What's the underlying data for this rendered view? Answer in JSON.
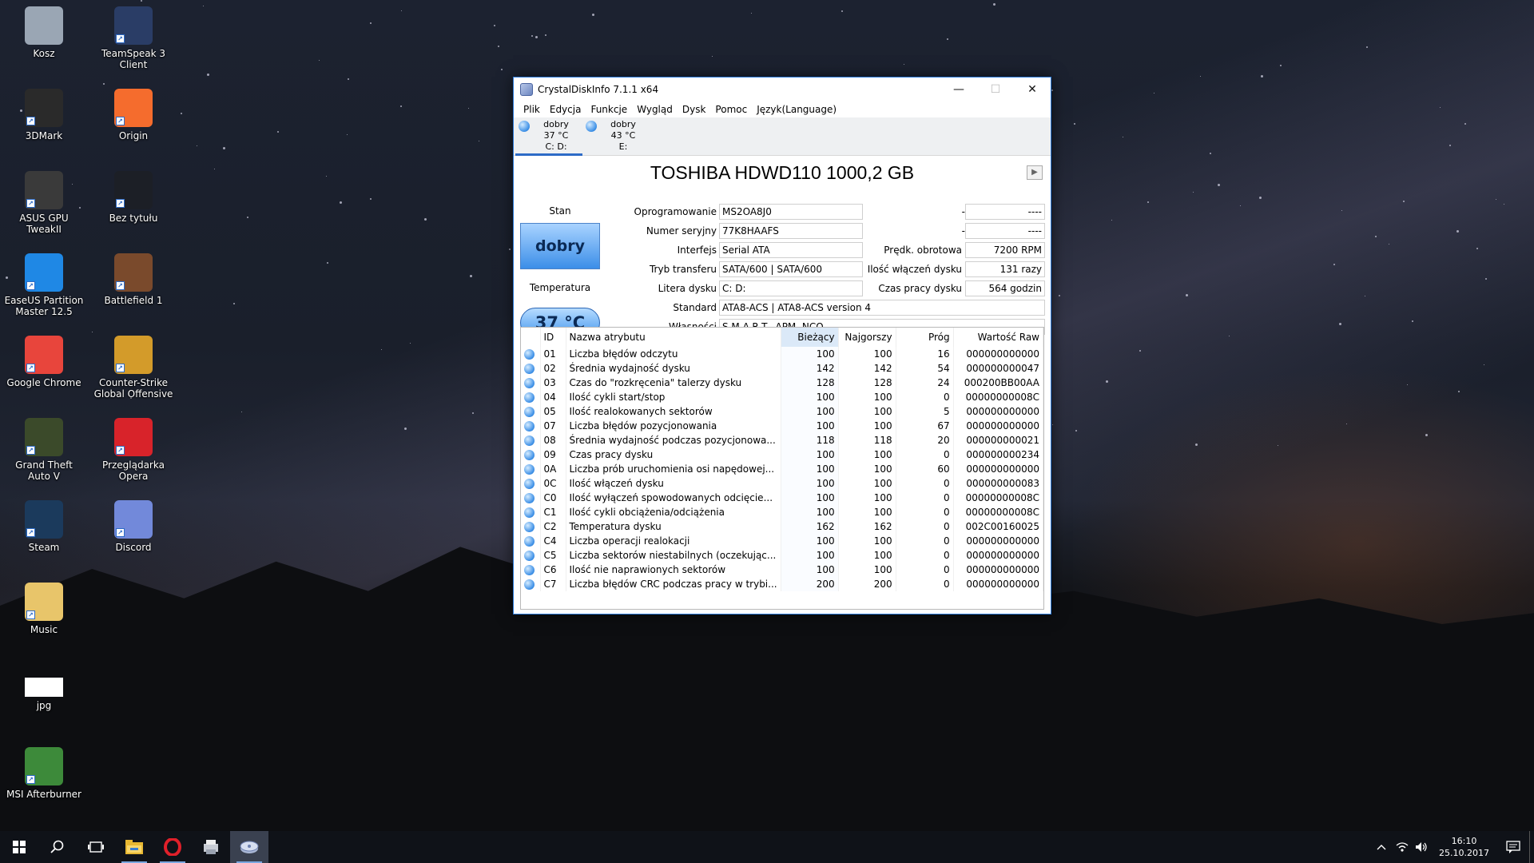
{
  "desktop": {
    "icons": [
      {
        "label": "Kosz",
        "icon": "recycle-bin-icon",
        "color": "#9aa6b4"
      },
      {
        "label": "TeamSpeak 3 Client",
        "icon": "teamspeak-icon",
        "color": "#2a3d66"
      },
      {
        "label": "3DMark",
        "icon": "3dmark-icon",
        "color": "#2a2a2a"
      },
      {
        "label": "Origin",
        "icon": "origin-icon",
        "color": "#f56c2d"
      },
      {
        "label": "ASUS GPU TweakII",
        "icon": "asus-gpu-tweak-icon",
        "color": "#3a3a3a"
      },
      {
        "label": "Bez tytułu",
        "icon": "untitled-image-icon",
        "color": "#1c1f26"
      },
      {
        "label": "EaseUS Partition Master 12.5",
        "icon": "easeus-icon",
        "color": "#1f88e5"
      },
      {
        "label": "Battlefield 1",
        "icon": "battlefield-icon",
        "color": "#7a4a2c"
      },
      {
        "label": "Google Chrome",
        "icon": "chrome-icon",
        "color": "#e8453c"
      },
      {
        "label": "Counter-Strike Global Offensive",
        "icon": "csgo-icon",
        "color": "#d39b2a"
      },
      {
        "label": "Grand Theft Auto V",
        "icon": "gta-icon",
        "color": "#3b4a2a"
      },
      {
        "label": "Przeglądarka Opera",
        "icon": "opera-icon",
        "color": "#d8232a"
      },
      {
        "label": "Steam",
        "icon": "steam-icon",
        "color": "#1b3a5c"
      },
      {
        "label": "Discord",
        "icon": "discord-icon",
        "color": "#7289da"
      },
      {
        "label": "Music",
        "icon": "music-folder-icon",
        "color": "#e8c56a"
      },
      {
        "label": "jpg",
        "icon": "blank-file-icon",
        "color": "#ffffff"
      },
      {
        "label": "MSI Afterburner",
        "icon": "msi-afterburner-icon",
        "color": "#3d8a3a"
      }
    ]
  },
  "window": {
    "title": "CrystalDiskInfo 7.1.1 x64",
    "menu": [
      "Plik",
      "Edycja",
      "Funkcje",
      "Wygląd",
      "Dysk",
      "Pomoc",
      "Język(Language)"
    ],
    "drives": [
      {
        "status": "dobry",
        "temp": "37 °C",
        "letter": "C: D:"
      },
      {
        "status": "dobry",
        "temp": "43 °C",
        "letter": "E:"
      }
    ],
    "disk_title": "TOSHIBA HDWD110 1000,2 GB",
    "status_label": "Stan",
    "status_value": "dobry",
    "temp_label": "Temperatura",
    "temp_value": "37 °C",
    "fields": {
      "firmware": {
        "label": "Oprogramowanie",
        "value": "MS2OA8J0"
      },
      "serial": {
        "label": "Numer seryjny",
        "value": "77K8HAAFS"
      },
      "interface": {
        "label": "Interfejs",
        "value": "Serial ATA"
      },
      "transfer": {
        "label": "Tryb transferu",
        "value": "SATA/600 | SATA/600"
      },
      "letter": {
        "label": "Litera dysku",
        "value": "C: D:"
      },
      "standard": {
        "label": "Standard",
        "value": "ATA8-ACS | ATA8-ACS version 4"
      },
      "features": {
        "label": "Własności",
        "value": "S.M.A.R.T., APM, NCQ"
      },
      "blank1": {
        "label": "----",
        "value": "----"
      },
      "blank2": {
        "label": "----",
        "value": "----"
      },
      "rotation": {
        "label": "Prędk. obrotowa",
        "value": "7200 RPM"
      },
      "power_count": {
        "label": "Ilość włączeń dysku",
        "value": "131 razy"
      },
      "power_hours": {
        "label": "Czas pracy dysku",
        "value": "564 godzin"
      }
    },
    "smart": {
      "headers": [
        "ID",
        "Nazwa atrybutu",
        "Bieżący",
        "Najgorszy",
        "Próg",
        "Wartość Raw"
      ],
      "rows": [
        {
          "id": "01",
          "name": "Liczba błędów odczytu",
          "cur": "100",
          "worst": "100",
          "thr": "16",
          "raw": "000000000000"
        },
        {
          "id": "02",
          "name": "Średnia wydajność dysku",
          "cur": "142",
          "worst": "142",
          "thr": "54",
          "raw": "000000000047"
        },
        {
          "id": "03",
          "name": "Czas do \"rozkręcenia\" talerzy dysku",
          "cur": "128",
          "worst": "128",
          "thr": "24",
          "raw": "000200BB00AA"
        },
        {
          "id": "04",
          "name": "Ilość cykli start/stop",
          "cur": "100",
          "worst": "100",
          "thr": "0",
          "raw": "00000000008C"
        },
        {
          "id": "05",
          "name": "Ilość realokowanych sektorów",
          "cur": "100",
          "worst": "100",
          "thr": "5",
          "raw": "000000000000"
        },
        {
          "id": "07",
          "name": "Liczba błędów pozycjonowania",
          "cur": "100",
          "worst": "100",
          "thr": "67",
          "raw": "000000000000"
        },
        {
          "id": "08",
          "name": "Średnia wydajność podczas pozycjonowa...",
          "cur": "118",
          "worst": "118",
          "thr": "20",
          "raw": "000000000021"
        },
        {
          "id": "09",
          "name": "Czas pracy dysku",
          "cur": "100",
          "worst": "100",
          "thr": "0",
          "raw": "000000000234"
        },
        {
          "id": "0A",
          "name": "Liczba prób uruchomienia osi napędowej...",
          "cur": "100",
          "worst": "100",
          "thr": "60",
          "raw": "000000000000"
        },
        {
          "id": "0C",
          "name": "Ilość włączeń dysku",
          "cur": "100",
          "worst": "100",
          "thr": "0",
          "raw": "000000000083"
        },
        {
          "id": "C0",
          "name": "Ilość wyłączeń spowodowanych odcięcie...",
          "cur": "100",
          "worst": "100",
          "thr": "0",
          "raw": "00000000008C"
        },
        {
          "id": "C1",
          "name": "Ilość cykli obciążenia/odciążenia",
          "cur": "100",
          "worst": "100",
          "thr": "0",
          "raw": "00000000008C"
        },
        {
          "id": "C2",
          "name": "Temperatura dysku",
          "cur": "162",
          "worst": "162",
          "thr": "0",
          "raw": "002C00160025"
        },
        {
          "id": "C4",
          "name": "Liczba operacji realokacji",
          "cur": "100",
          "worst": "100",
          "thr": "0",
          "raw": "000000000000"
        },
        {
          "id": "C5",
          "name": "Liczba sektorów niestabilnych (oczekując...",
          "cur": "100",
          "worst": "100",
          "thr": "0",
          "raw": "000000000000"
        },
        {
          "id": "C6",
          "name": "Ilość nie naprawionych sektorów",
          "cur": "100",
          "worst": "100",
          "thr": "0",
          "raw": "000000000000"
        },
        {
          "id": "C7",
          "name": "Liczba błędów CRC podczas pracy w trybi...",
          "cur": "200",
          "worst": "200",
          "thr": "0",
          "raw": "000000000000"
        }
      ]
    }
  },
  "taskbar": {
    "time": "16:10",
    "date": "25.10.2017"
  }
}
